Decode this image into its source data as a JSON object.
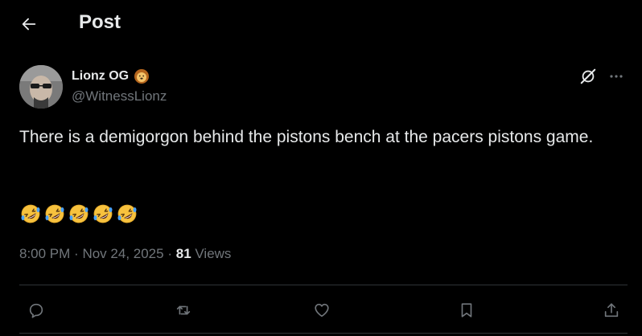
{
  "header": {
    "title": "Post",
    "back_icon": "arrow-left-icon"
  },
  "post": {
    "author": {
      "name": "Lionz OG",
      "badge_icon": "lion-face-icon",
      "handle": "@WitnessLionz"
    },
    "text": "There is a demigorgon behind the pistons bench at the pacers pistons game.",
    "emojis": "🤣🤣🤣🤣🤣",
    "emoji_icon": "rolling-on-floor-laughing-icon",
    "time": "8:00 PM",
    "date": "Nov 24, 2025",
    "views_count": "81",
    "views_label": "Views",
    "separator": "·"
  },
  "actions": {
    "icons": [
      "reply-icon",
      "repost-icon",
      "like-icon",
      "bookmark-icon",
      "share-icon"
    ]
  },
  "colors": {
    "background": "#000000",
    "text_primary": "#e7e9ea",
    "text_secondary": "#71767b",
    "divider": "#2f3336"
  }
}
